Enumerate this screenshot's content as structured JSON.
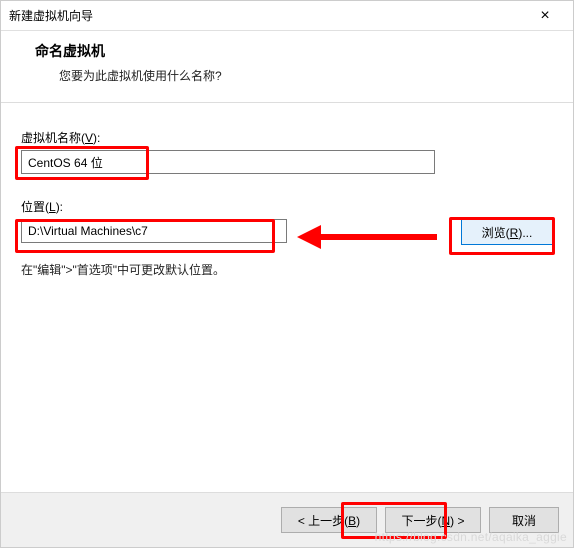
{
  "window": {
    "title": "新建虚拟机向导"
  },
  "header": {
    "title": "命名虚拟机",
    "subtitle": "您要为此虚拟机使用什么名称?"
  },
  "fields": {
    "name_label_prefix": "虚拟机名称(",
    "name_label_u": "V",
    "name_label_suffix": "):",
    "name_value": "CentOS 64 位",
    "loc_label_prefix": "位置(",
    "loc_label_u": "L",
    "loc_label_suffix": "):",
    "loc_value": "D:\\Virtual Machines\\c7",
    "browse_prefix": "浏览(",
    "browse_u": "R",
    "browse_suffix": ")..."
  },
  "hint": "在\"编辑\">\"首选项\"中可更改默认位置。",
  "footer": {
    "back_prefix": "< 上一步(",
    "back_u": "B",
    "back_suffix": ")",
    "next_prefix": "下一步(",
    "next_u": "N",
    "next_suffix": ") >",
    "cancel": "取消"
  },
  "watermark": "https://blog.csdn.net/aqaika_aggie"
}
